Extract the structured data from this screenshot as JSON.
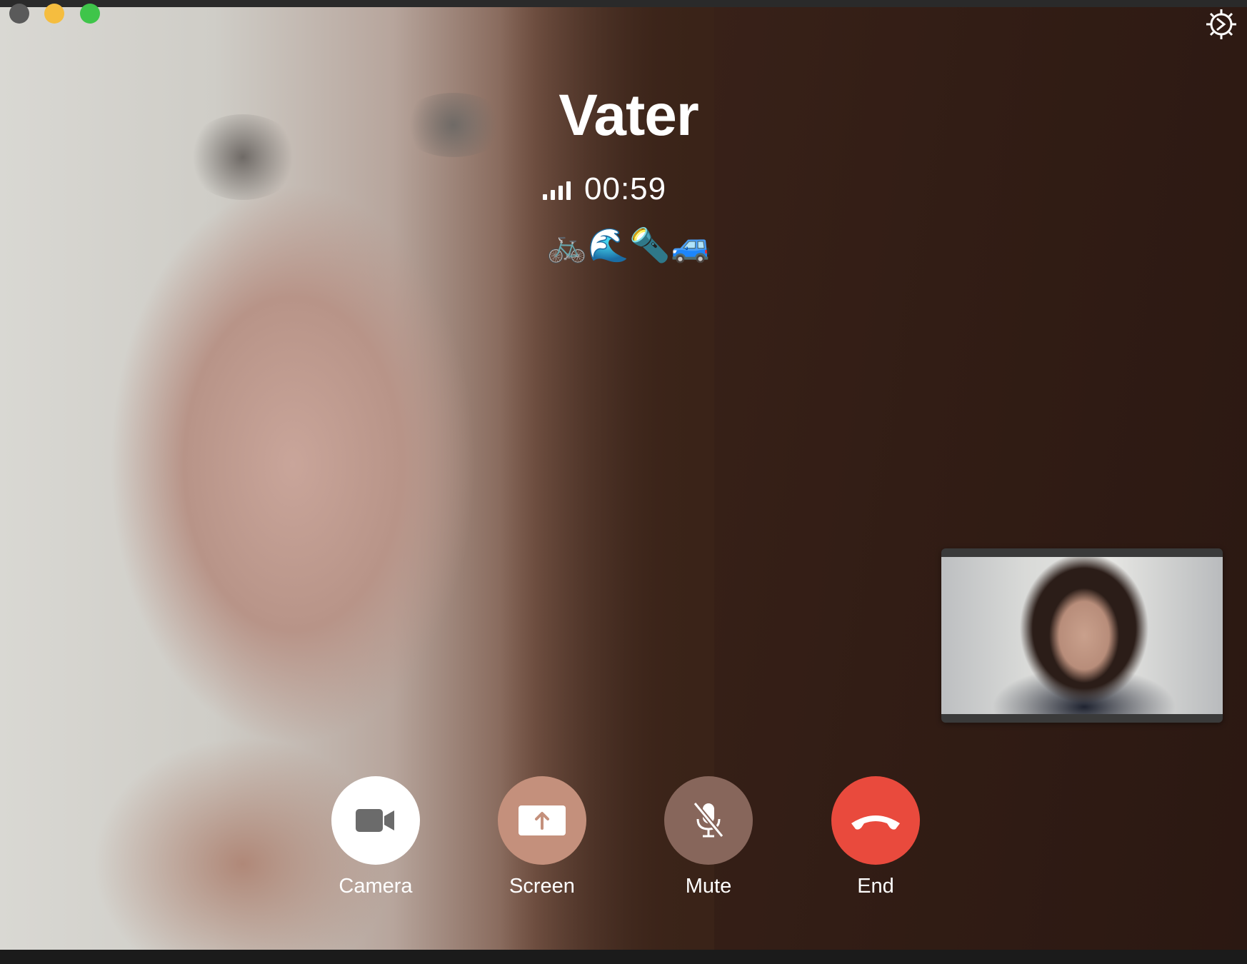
{
  "window": {
    "traffic_lights": [
      "close",
      "minimize",
      "maximize"
    ],
    "settings_icon": "gear-icon"
  },
  "call": {
    "contact_name": "Vater",
    "signal_icon": "signal-bars-icon",
    "duration": "00:59",
    "emojis": [
      "🚲",
      "🌊",
      "🔦",
      "🚙"
    ]
  },
  "videos": {
    "remote": "remote-video",
    "self": "self-view"
  },
  "controls": {
    "camera_label": "Camera",
    "screen_label": "Screen",
    "mute_label": "Mute",
    "end_label": "End"
  },
  "colors": {
    "background": "#3a2318",
    "end_button": "#e94a3d",
    "screen_button": "#c4907c",
    "mute_button": "#87665b",
    "camera_button": "#ffffff",
    "traffic_min": "#f5bd3f",
    "traffic_max": "#3fc54a"
  }
}
